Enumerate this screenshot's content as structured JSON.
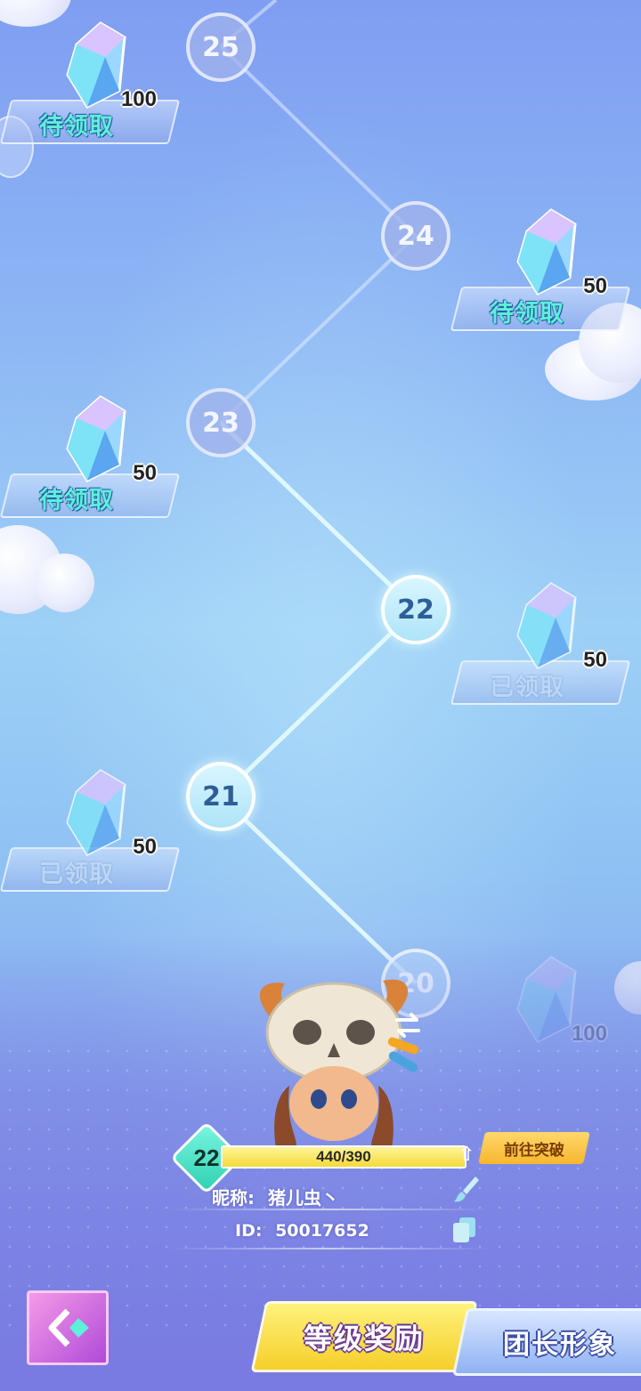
{
  "levels": [
    {
      "num": "25",
      "state": "locked"
    },
    {
      "num": "24",
      "state": "locked"
    },
    {
      "num": "23",
      "state": "locked"
    },
    {
      "num": "22",
      "state": "done"
    },
    {
      "num": "21",
      "state": "done"
    },
    {
      "num": "20",
      "state": "current"
    }
  ],
  "rewards": [
    {
      "level": "25",
      "amount": "100",
      "status": "待领取"
    },
    {
      "level": "24",
      "amount": "50",
      "status": "待领取"
    },
    {
      "level": "23",
      "amount": "50",
      "status": "待领取"
    },
    {
      "level": "22",
      "amount": "50",
      "status": "已领取"
    },
    {
      "level": "21",
      "amount": "50",
      "status": "已领取"
    },
    {
      "level": "20",
      "amount": "100",
      "status": ""
    }
  ],
  "player": {
    "level": "22",
    "xp_text": "440/390",
    "xp_fraction": 1.0,
    "nickname_label": "昵称:",
    "nickname": "猪儿虫丶",
    "id_label": "ID:",
    "id": "50017652",
    "breakthrough_label": "前往突破"
  },
  "tabs": {
    "level_rewards": "等级奖励",
    "avatar": "团长形象"
  },
  "icons": {
    "switch": "swap-arrows-icon",
    "edit": "brush-icon",
    "copy": "copy-icon",
    "back": "double-chevron-left-icon",
    "upgrade": "arrow-up-icon"
  },
  "colors": {
    "pending_text": "#5ef0d8",
    "accent_yellow": "#f5cf2a",
    "back_button": "#b04ad8"
  }
}
